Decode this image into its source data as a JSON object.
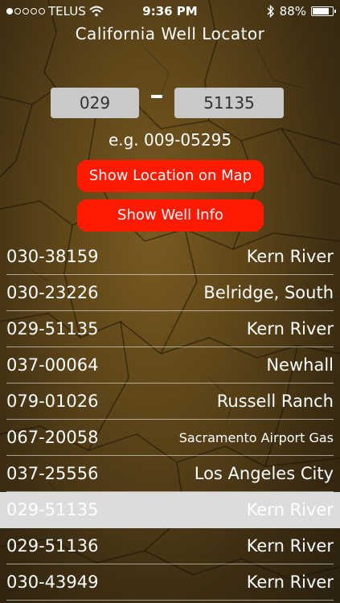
{
  "status": {
    "carrier": "TELUS",
    "time": "9:36 PM",
    "battery": "88%",
    "battery_level": 0.88,
    "signal_bars_filled": 1,
    "signal_bars_total": 5
  },
  "title": "California Well Locator",
  "inputs": {
    "prefix": "029",
    "number": "51135"
  },
  "example": "e.g. 009-05295",
  "buttons": {
    "map": "Show Location on Map",
    "info": "Show Well Info"
  },
  "wells": [
    {
      "id": "030-38159",
      "name": "Kern River"
    },
    {
      "id": "030-23226",
      "name": "Belridge, South"
    },
    {
      "id": "029-51135",
      "name": "Kern River"
    },
    {
      "id": "037-00064",
      "name": "Newhall"
    },
    {
      "id": "079-01026",
      "name": "Russell Ranch"
    },
    {
      "id": "067-20058",
      "name": "Sacramento Airport Gas"
    },
    {
      "id": "037-25556",
      "name": "Los Angeles City"
    },
    {
      "id": "029-51135",
      "name": "Kern River"
    },
    {
      "id": "029-51136",
      "name": "Kern River"
    },
    {
      "id": "030-43949",
      "name": "Kern River"
    }
  ]
}
